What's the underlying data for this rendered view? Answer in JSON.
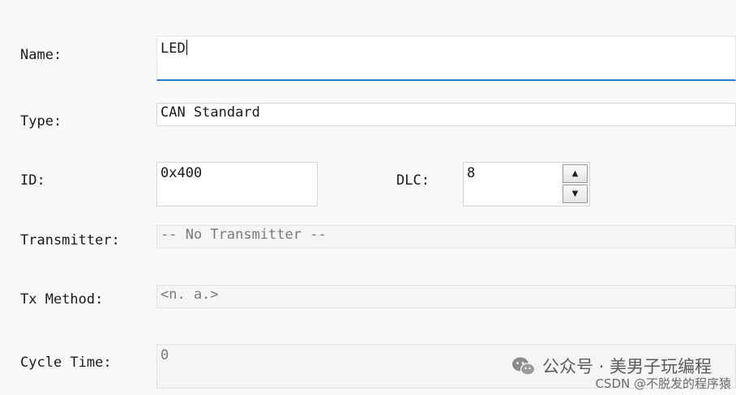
{
  "form": {
    "name": {
      "label": "Name:",
      "value": "LED"
    },
    "type": {
      "label": "Type:",
      "value": "CAN Standard"
    },
    "id": {
      "label": "ID:",
      "value": "0x400"
    },
    "dlc": {
      "label": "DLC:",
      "value": "8",
      "up": "▲",
      "down": "▼"
    },
    "transmitter": {
      "label": "Transmitter:",
      "value": "-- No Transmitter --"
    },
    "tx_method": {
      "label": "Tx Method:",
      "value": "<n. a.>"
    },
    "cycle_time": {
      "label": "Cycle Time:",
      "value": "0"
    }
  },
  "watermark": {
    "main": "公众号 · 美男子玩编程",
    "sub": "CSDN @不脱发的程序猿",
    "icon": "wechat-icon"
  },
  "colors": {
    "focus_underline": "#2a7bd0",
    "background": "#f9f9f9"
  }
}
